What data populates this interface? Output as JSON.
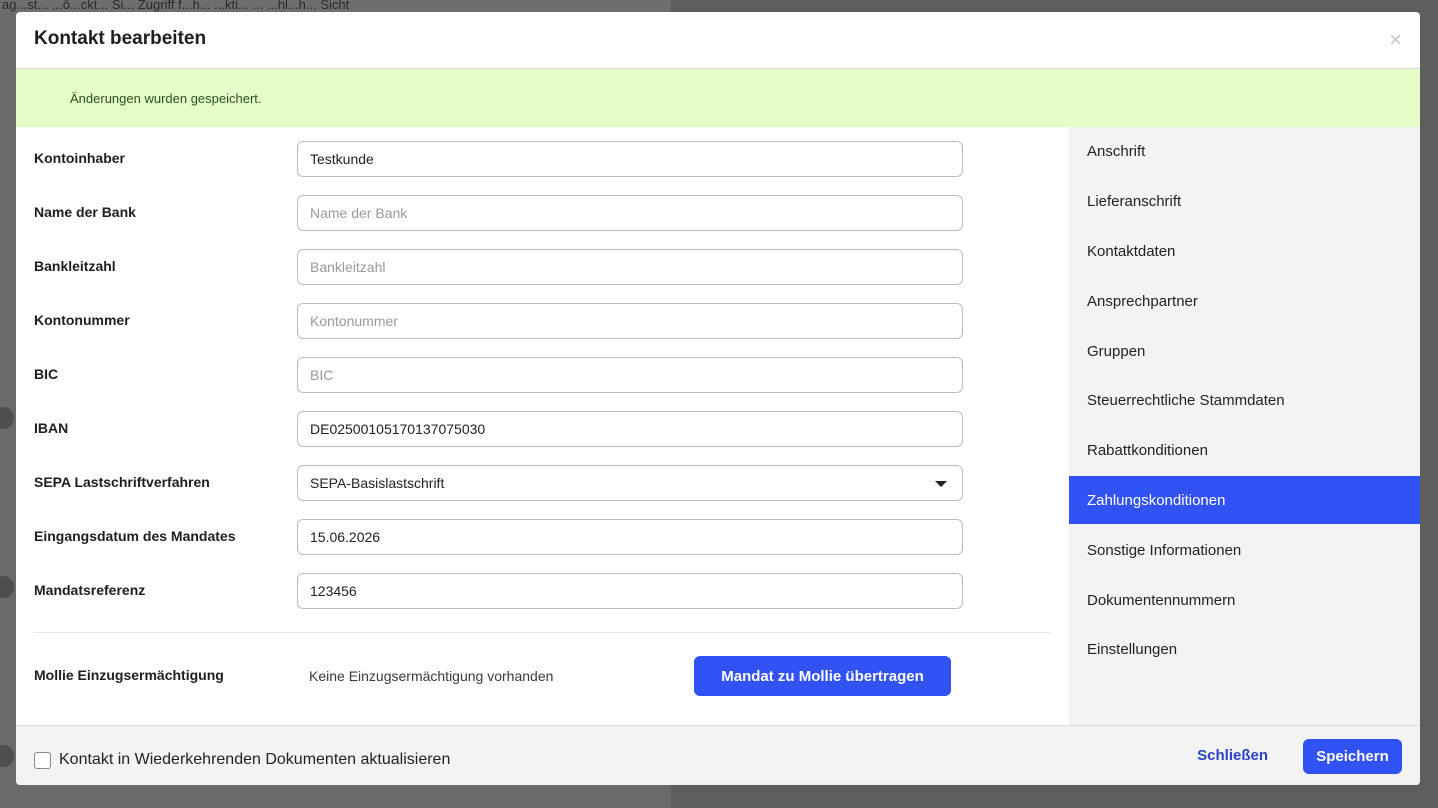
{
  "background": {
    "top_text": "ag...st... ...ö...ckt... Si... Zugriff f...h... ...kti... ... ...hl...h... Sicht"
  },
  "modal": {
    "title": "Kontakt bearbeiten",
    "close_glyph": "×",
    "success_message": "Änderungen wurden gespeichert."
  },
  "form": {
    "fields": [
      {
        "label": "Kontoinhaber",
        "value": "Testkunde",
        "placeholder": "Kontoinhaber"
      },
      {
        "label": "Name der Bank",
        "value": "",
        "placeholder": "Name der Bank"
      },
      {
        "label": "Bankleitzahl",
        "value": "",
        "placeholder": "Bankleitzahl"
      },
      {
        "label": "Kontonummer",
        "value": "",
        "placeholder": "Kontonummer"
      },
      {
        "label": "BIC",
        "value": "",
        "placeholder": "BIC"
      },
      {
        "label": "IBAN",
        "value": "DE02500105170137075030",
        "placeholder": "IBAN"
      },
      {
        "label": "SEPA Lastschriftverfahren",
        "value": "SEPA-Basislastschrift"
      },
      {
        "label": "Eingangsdatum des Mandates",
        "value": "15.06.2026",
        "placeholder": "Eingangsdatum des Mandates"
      },
      {
        "label": "Mandatsreferenz",
        "value": "123456",
        "placeholder": "Mandatsreferenz"
      }
    ],
    "mollie": {
      "label": "Mollie Einzugsermächtigung",
      "status": "Keine Einzugsermächtigung vorhanden",
      "button": "Mandat zu Mollie übertragen"
    }
  },
  "side_nav": {
    "items": [
      {
        "label": "Anschrift",
        "active": false
      },
      {
        "label": "Lieferanschrift",
        "active": false
      },
      {
        "label": "Kontaktdaten",
        "active": false
      },
      {
        "label": "Ansprechpartner",
        "active": false
      },
      {
        "label": "Gruppen",
        "active": false
      },
      {
        "label": "Steuerrechtliche Stammdaten",
        "active": false
      },
      {
        "label": "Rabattkonditionen",
        "active": false
      },
      {
        "label": "Zahlungskonditionen",
        "active": true
      },
      {
        "label": "Sonstige Informationen",
        "active": false
      },
      {
        "label": "Dokumentennummern",
        "active": false
      },
      {
        "label": "Einstellungen",
        "active": false
      }
    ]
  },
  "footer": {
    "checkbox_label": "Kontakt in Wiederkehrenden Dokumenten aktualisieren",
    "checkbox_checked": false,
    "close_label": "Schließen",
    "save_label": "Speichern"
  },
  "colors": {
    "accent": "#3152f5",
    "success_bg": "#e4fcc5",
    "nav_bg": "#f3f3f3"
  }
}
